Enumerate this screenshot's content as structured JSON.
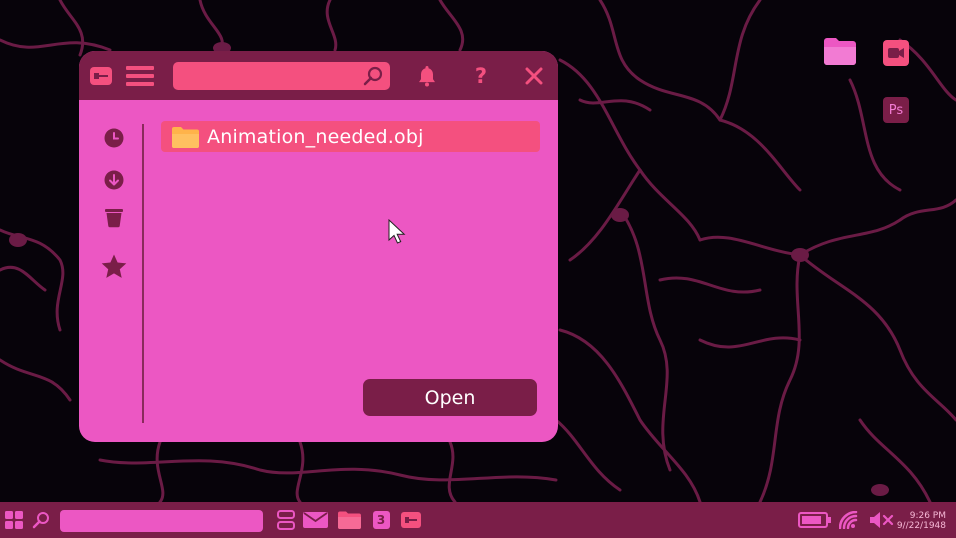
{
  "colors": {
    "window_bg": "#ec57c3",
    "titlebar_bg": "#7a1e48",
    "accent": "#f4507f",
    "desktop_bg": "#07030a",
    "vein": "#6a1b45",
    "folder": "#ffb34a"
  },
  "desktop": {
    "icons": [
      "folder-icon",
      "video-camera-icon",
      "photoshop-icon"
    ],
    "photoshop_label": "Ps"
  },
  "window": {
    "titlebar_icons": [
      "key-icon",
      "menu-icon",
      "bell-icon",
      "help-icon",
      "close-icon"
    ],
    "search": {
      "placeholder": "",
      "value": ""
    },
    "sidebar_icons": [
      "clock-icon",
      "download-icon",
      "trash-icon",
      "star-icon"
    ],
    "files": [
      {
        "name": "Animation_needed.obj",
        "icon": "folder-icon"
      }
    ],
    "open_label": "Open"
  },
  "taskbar": {
    "search": {
      "placeholder": "",
      "value": ""
    },
    "icons": [
      "start-grid-icon",
      "search-icon",
      "task-view-icon",
      "mail-icon",
      "folder-icon",
      "app-3-icon",
      "key-icon",
      "battery-icon",
      "wifi-icon",
      "muted-speaker-icon"
    ],
    "app_badge": "3",
    "time": "9:26 PM",
    "date": "9//22/1948"
  }
}
